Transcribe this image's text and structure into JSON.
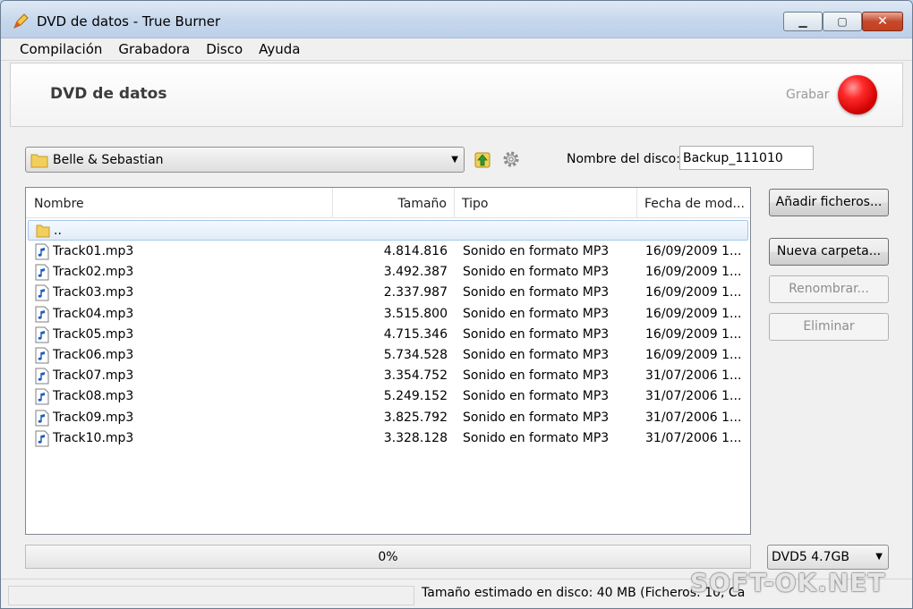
{
  "window": {
    "title": "DVD de datos - True Burner",
    "min_glyph": "▁",
    "max_glyph": "▢",
    "close_glyph": "✕"
  },
  "menu": [
    "Compilación",
    "Grabadora",
    "Disco",
    "Ayuda"
  ],
  "header": {
    "title": "DVD de datos",
    "burn_label": "Grabar"
  },
  "toolbar": {
    "folder_selected": "Belle & Sebastian",
    "disc_name_label": "Nombre del disco:",
    "disc_name_value": "Backup_111010"
  },
  "filelist": {
    "columns": [
      "Nombre",
      "Tamaño",
      "Tipo",
      "Fecha de mod..."
    ],
    "parent_label": "..",
    "rows": [
      {
        "name": "Track01.mp3",
        "size": "4.814.816",
        "type": "Sonido en formato MP3",
        "date": "16/09/2009 1..."
      },
      {
        "name": "Track02.mp3",
        "size": "3.492.387",
        "type": "Sonido en formato MP3",
        "date": "16/09/2009 1..."
      },
      {
        "name": "Track03.mp3",
        "size": "2.337.987",
        "type": "Sonido en formato MP3",
        "date": "16/09/2009 1..."
      },
      {
        "name": "Track04.mp3",
        "size": "3.515.800",
        "type": "Sonido en formato MP3",
        "date": "16/09/2009 1..."
      },
      {
        "name": "Track05.mp3",
        "size": "4.715.346",
        "type": "Sonido en formato MP3",
        "date": "16/09/2009 1..."
      },
      {
        "name": "Track06.mp3",
        "size": "5.734.528",
        "type": "Sonido en formato MP3",
        "date": "16/09/2009 1..."
      },
      {
        "name": "Track07.mp3",
        "size": "3.354.752",
        "type": "Sonido en formato MP3",
        "date": "31/07/2006 1..."
      },
      {
        "name": "Track08.mp3",
        "size": "5.249.152",
        "type": "Sonido en formato MP3",
        "date": "31/07/2006 1..."
      },
      {
        "name": "Track09.mp3",
        "size": "3.825.792",
        "type": "Sonido en formato MP3",
        "date": "31/07/2006 1..."
      },
      {
        "name": "Track10.mp3",
        "size": "3.328.128",
        "type": "Sonido en formato MP3",
        "date": "31/07/2006 1..."
      }
    ]
  },
  "buttons": {
    "add_files": "Añadir ficheros...",
    "new_folder": "Nueva carpeta...",
    "rename": "Renombrar...",
    "delete": "Eliminar"
  },
  "progress": {
    "text": "0%",
    "value": 0
  },
  "disc_type": {
    "selected": "DVD5 4.7GB"
  },
  "status": {
    "text": "Tamaño estimado en disco: 40 MB (Ficheros: 10, Ca"
  },
  "watermark": "SOFT-OK.NET",
  "colors": {
    "burn_button": "#e00000",
    "selection": "#e1ecf8",
    "title_bar": "#c6d7ec"
  },
  "icons": {
    "app": "burner-pencil-icon",
    "folder": "folder-icon",
    "up_folder": "folder-up-icon",
    "settings": "gear-icon",
    "audio_file": "audio-file-icon"
  }
}
